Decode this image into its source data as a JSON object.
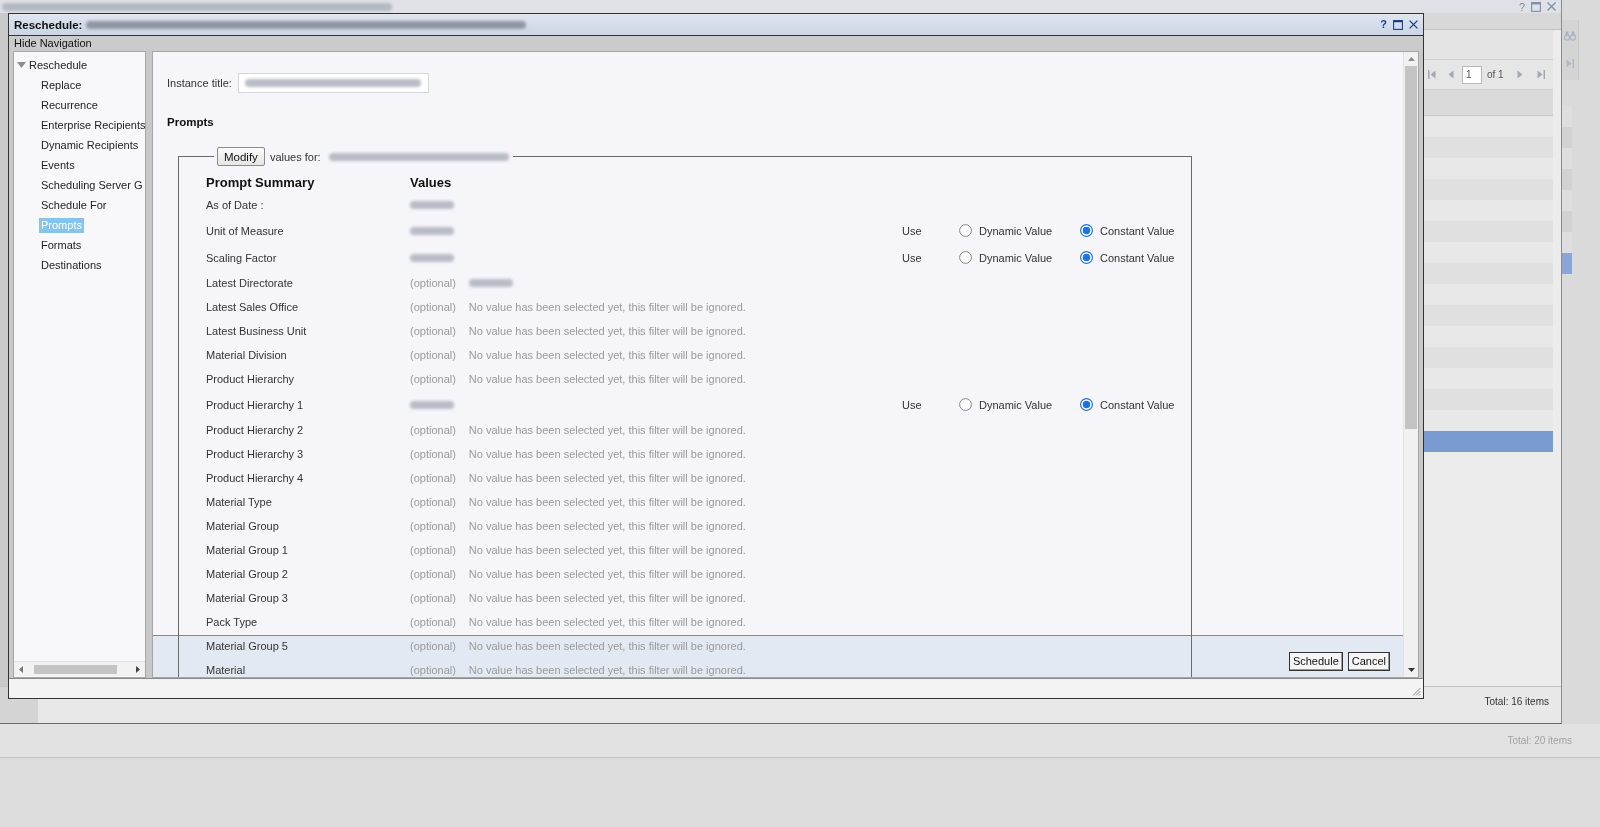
{
  "background_window": {
    "title_blurred": true,
    "help": "?",
    "pager": {
      "page": "1",
      "of": "of 1"
    },
    "rows": [
      {
        "selected": false
      },
      {
        "selected": false
      },
      {
        "selected": false
      },
      {
        "selected": false
      },
      {
        "selected": false
      },
      {
        "selected": false
      },
      {
        "selected": false
      },
      {
        "selected": false
      },
      {
        "selected": false
      },
      {
        "selected": false
      },
      {
        "selected": false
      },
      {
        "selected": false
      },
      {
        "selected": false
      },
      {
        "selected": false
      },
      {
        "selected": false
      },
      {
        "selected": true
      }
    ],
    "status": "Total: 16 items"
  },
  "rear_window": {
    "rows": [
      {
        "selected": false
      },
      {
        "selected": false
      },
      {
        "selected": false
      },
      {
        "selected": false
      },
      {
        "selected": false
      },
      {
        "selected": false
      },
      {
        "selected": false
      },
      {
        "selected": true
      }
    ],
    "status": "Total: 20 items"
  },
  "dialog": {
    "title": "Reschedule:",
    "title_blurred": true,
    "help": "?",
    "nav_toggle": "Hide Navigation",
    "nav": [
      {
        "label": "Reschedule",
        "expanded": true,
        "children": [
          {
            "label": "Replace",
            "selected": false
          },
          {
            "label": "Recurrence",
            "selected": false
          },
          {
            "label": "Enterprise Recipients",
            "selected": false
          },
          {
            "label": "Dynamic Recipients",
            "selected": false
          },
          {
            "label": "Events",
            "selected": false
          },
          {
            "label": "Scheduling Server G",
            "selected": false
          },
          {
            "label": "Schedule For",
            "selected": false
          },
          {
            "label": "Prompts",
            "selected": true
          },
          {
            "label": "Formats",
            "selected": false
          },
          {
            "label": "Destinations",
            "selected": false
          }
        ]
      }
    ],
    "instance_title": {
      "label": "Instance title:",
      "value_blurred": true
    },
    "section_title": "Prompts",
    "prompts": {
      "modify_button": "Modify",
      "values_for": "values for:",
      "target_blurred": true,
      "columns": [
        "Prompt Summary",
        "Values"
      ],
      "rows": [
        {
          "label": "As of Date :",
          "value_blurred": true
        },
        {
          "label": "Unit of Measure",
          "value_blurred": true,
          "use": {
            "label": "Use",
            "options": [
              {
                "label": "Dynamic Value",
                "selected": false
              },
              {
                "label": "Constant Value",
                "selected": true
              }
            ]
          }
        },
        {
          "label": "Scaling Factor",
          "value_blurred": true,
          "use": {
            "label": "Use",
            "options": [
              {
                "label": "Dynamic Value",
                "selected": false
              },
              {
                "label": "Constant Value",
                "selected": true
              }
            ]
          }
        },
        {
          "label": "Latest Directorate",
          "optional": "(optional)",
          "value_blurred": true
        },
        {
          "label": "Latest Sales Office",
          "optional": "(optional)",
          "message": "No value has been selected yet, this filter will be ignored."
        },
        {
          "label": "Latest Business Unit",
          "optional": "(optional)",
          "message": "No value has been selected yet, this filter will be ignored."
        },
        {
          "label": "Material Division",
          "optional": "(optional)",
          "message": "No value has been selected yet, this filter will be ignored."
        },
        {
          "label": "Product Hierarchy",
          "optional": "(optional)",
          "message": "No value has been selected yet, this filter will be ignored."
        },
        {
          "label": "Product Hierarchy 1",
          "value_blurred": true,
          "use": {
            "label": "Use",
            "options": [
              {
                "label": "Dynamic Value",
                "selected": false
              },
              {
                "label": "Constant Value",
                "selected": true
              }
            ]
          }
        },
        {
          "label": "Product Hierarchy 2",
          "optional": "(optional)",
          "message": "No value has been selected yet, this filter will be ignored."
        },
        {
          "label": "Product Hierarchy 3",
          "optional": "(optional)",
          "message": "No value has been selected yet, this filter will be ignored."
        },
        {
          "label": "Product Hierarchy 4",
          "optional": "(optional)",
          "message": "No value has been selected yet, this filter will be ignored."
        },
        {
          "label": "Material Type",
          "optional": "(optional)",
          "message": "No value has been selected yet, this filter will be ignored."
        },
        {
          "label": "Material Group",
          "optional": "(optional)",
          "message": "No value has been selected yet, this filter will be ignored."
        },
        {
          "label": "Material Group 1",
          "optional": "(optional)",
          "message": "No value has been selected yet, this filter will be ignored."
        },
        {
          "label": "Material Group 2",
          "optional": "(optional)",
          "message": "No value has been selected yet, this filter will be ignored."
        },
        {
          "label": "Material Group 3",
          "optional": "(optional)",
          "message": "No value has been selected yet, this filter will be ignored."
        },
        {
          "label": "Pack Type",
          "optional": "(optional)",
          "message": "No value has been selected yet, this filter will be ignored."
        },
        {
          "label": "Material Group 5",
          "optional": "(optional)",
          "message": "No value has been selected yet, this filter will be ignored."
        },
        {
          "label": "Material",
          "optional": "(optional)",
          "message": "No value has been selected yet, this filter will be ignored."
        }
      ]
    },
    "buttons": [
      {
        "label": "Schedule"
      },
      {
        "label": "Cancel"
      }
    ]
  }
}
